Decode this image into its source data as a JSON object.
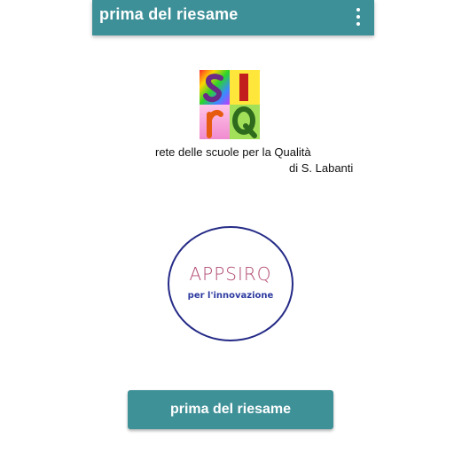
{
  "appbar": {
    "title": "prima del riesame",
    "menu_icon": "more-vert-icon"
  },
  "brand": {
    "logo_letters": [
      "s",
      "I",
      "r",
      "Q"
    ],
    "tagline": "rete delle scuole per la Qualità",
    "author": "di S. Labanti"
  },
  "app_logo": {
    "name": "APPSIRQ",
    "subtitle": "per l'innovazione"
  },
  "actions": {
    "main_button_label": "prima del riesame"
  },
  "colors": {
    "primary": "#3d9098",
    "circle_border": "#242a86",
    "logo_text": "#b14a72",
    "logo_subtitle": "#2d3aa0"
  }
}
